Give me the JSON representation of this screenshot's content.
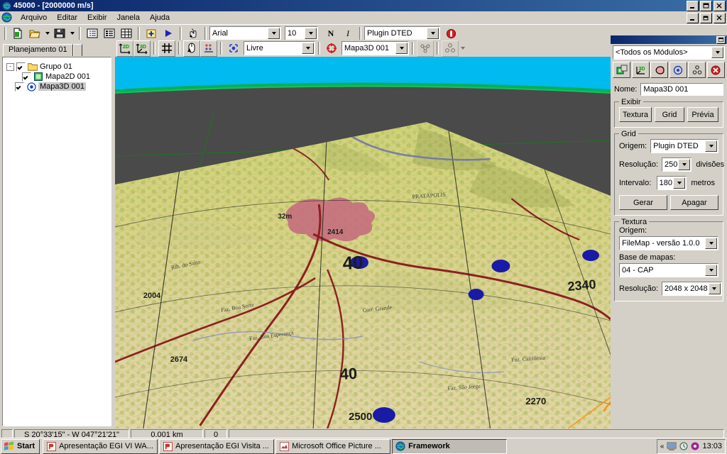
{
  "window": {
    "title": "45000 - [2000000 m/s]",
    "icon": "globe-icon",
    "minimize": "_",
    "maximize": "❐",
    "close": "✕"
  },
  "child_window": {
    "minimize": "_",
    "restore": "❐",
    "close": "✕"
  },
  "menu": {
    "items": [
      {
        "label": "Arquivo"
      },
      {
        "label": "Editar"
      },
      {
        "label": "Exibir"
      },
      {
        "label": "Janela"
      },
      {
        "label": "Ajuda"
      }
    ]
  },
  "main_toolbar": {
    "buttons": [
      {
        "name": "new-document-button",
        "icon": "new-document-icon"
      },
      {
        "name": "open-folder-button",
        "icon": "open-folder-icon"
      },
      {
        "name": "open-folder-dropdown",
        "icon": "chevron-down-icon"
      },
      {
        "name": "save-button",
        "icon": "floppy-disk-icon"
      },
      {
        "name": "save-dropdown",
        "icon": "chevron-down-icon"
      },
      {
        "name": "tree-view-button",
        "icon": "tree-view-icon"
      },
      {
        "name": "list-view-button",
        "icon": "list-view-icon"
      },
      {
        "name": "table-view-button",
        "icon": "table-view-icon"
      },
      {
        "name": "add-item-button",
        "icon": "add-box-icon"
      },
      {
        "name": "play-button",
        "icon": "play-triangle-icon"
      },
      {
        "name": "pick-tool-button",
        "icon": "hand-pick-icon"
      }
    ],
    "font_name": "Arial",
    "font_size": "10",
    "bold_label": "N",
    "italic_label": "I",
    "plugin_value": "Plugin DTED",
    "stop_button": "stop-record-icon"
  },
  "view_toolbar": {
    "buttons": [
      {
        "name": "view-2d-button",
        "icon": "axis-2d-icon",
        "label": "2D"
      },
      {
        "name": "view-3d-button",
        "icon": "axis-3d-icon",
        "label": "3D"
      },
      {
        "name": "grid-button",
        "icon": "grid-hash-icon"
      },
      {
        "name": "mouse-nav-button",
        "icon": "mouse-icon"
      },
      {
        "name": "snap-points-button",
        "icon": "snap-points-icon"
      },
      {
        "name": "nav-mode-icon",
        "icon": "nav-mode-icon"
      },
      {
        "name": "target-icon",
        "icon": "target-ring-icon"
      },
      {
        "name": "link-objects-button",
        "icon": "link-nodes-icon"
      },
      {
        "name": "settings-nodes-button",
        "icon": "settings-nodes-icon"
      },
      {
        "name": "settings-dropdown",
        "icon": "chevron-down-icon"
      }
    ],
    "nav_mode_value": "Livre",
    "active_map_value": "Mapa3D 001"
  },
  "left_panel": {
    "tab_label": "Planejamento 01",
    "tree": [
      {
        "label": "Grupo 01",
        "icon": "folder-icon",
        "checked": true,
        "expander": "-",
        "depth": 0,
        "selected": false
      },
      {
        "label": "Mapa2D 001",
        "icon": "map2d-icon",
        "checked": true,
        "expander": "",
        "depth": 1,
        "selected": false
      },
      {
        "label": "Mapa3D 001",
        "icon": "map3d-icon",
        "checked": true,
        "expander": "",
        "depth": 0,
        "selected": true
      }
    ]
  },
  "right_panel": {
    "module_filter": "<Todos os Módulos>",
    "module_buttons": [
      {
        "name": "module-map2d-button",
        "icon": "map2d-module-icon"
      },
      {
        "name": "module-map3d-button",
        "icon": "map3d-module-icon"
      },
      {
        "name": "module-area-button",
        "icon": "area-shape-icon"
      },
      {
        "name": "module-point-button",
        "icon": "point-target-icon"
      },
      {
        "name": "module-network-button",
        "icon": "network-nodes-icon"
      },
      {
        "name": "module-stop-button",
        "icon": "stop-red-icon"
      }
    ],
    "name_label": "Nome:",
    "name_value": "Mapa3D 001",
    "exibir": {
      "legend": "Exibir",
      "buttons": [
        {
          "name": "textura-toggle",
          "label": "Textura"
        },
        {
          "name": "grid-toggle",
          "label": "Grid"
        },
        {
          "name": "previa-toggle",
          "label": "Prévia"
        }
      ]
    },
    "grid": {
      "legend": "Grid",
      "origem_label": "Origem:",
      "origem_value": "Plugin DTED",
      "resolucao_label": "Resolução:",
      "resolucao_value": "250",
      "resolucao_unit": "divisões",
      "intervalo_label": "Intervalo:",
      "intervalo_value": "180",
      "intervalo_unit": "metros",
      "gerar_label": "Gerar",
      "apagar_label": "Apagar"
    },
    "textura": {
      "legend": "Textura",
      "origem_label": "Origem:",
      "origem_value": "FileMap - versão 1.0.0",
      "base_label": "Base de mapas:",
      "base_value": "04 - CAP",
      "resolucao_label": "Resolução:",
      "resolucao_value": "2048 x 2048"
    }
  },
  "status_bar": {
    "coordinates": "S 20°33'15\"  -  W 047°21'21\"",
    "distance": "0.001 km",
    "count": "0",
    "extra": ""
  },
  "taskbar": {
    "start_label": "Start",
    "start_icon": "windows-flag-icon",
    "tasks": [
      {
        "label": "Apresentação EGI VI WA...",
        "icon": "powerpoint-icon",
        "active": false
      },
      {
        "label": "Apresentação EGI Visita ...",
        "icon": "powerpoint-icon",
        "active": false
      },
      {
        "label": "Microsoft Office Picture ...",
        "icon": "picture-manager-icon",
        "active": false
      },
      {
        "label": "Framework",
        "icon": "globe-icon",
        "active": true
      }
    ],
    "tray": {
      "expand_icon": "chevron-left-icon",
      "icons": [
        {
          "name": "network-tray-icon"
        },
        {
          "name": "clock-tray-icon"
        },
        {
          "name": "media-tray-icon"
        }
      ],
      "time": "13:03"
    }
  },
  "viewport": {
    "name": "map3d-viewport",
    "sky_color": "#00baf0",
    "ground_color": "#4a4a4a",
    "horizon_color": "#00b050",
    "axis_color": "#00a000"
  }
}
